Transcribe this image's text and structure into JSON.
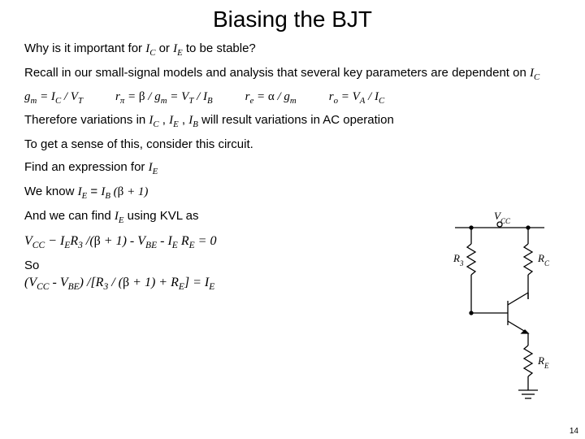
{
  "title": "Biasing the BJT",
  "why_pre": "Why is it important for ",
  "why_ic": "I",
  "why_icsub": "C",
  "why_or": " or ",
  "why_ie": "I",
  "why_iesub": "E",
  "why_post": " to be stable?",
  "recall_a": "Recall in our small-signal models and analysis that several key parameters are dependent on ",
  "recall_ic": "I",
  "recall_icsub": "C",
  "eq1_a": "g",
  "eq1_b": "m",
  "eq1_c": " = I",
  "eq1_d": "C",
  "eq1_e": " / V",
  "eq1_f": "T",
  "eq2_a": "r",
  "eq2_b": "π",
  "eq2_c": " = ",
  "eq2_d": "β",
  "eq2_e": " / g",
  "eq2_f": "m",
  "eq2_g": " = V",
  "eq2_h": "T",
  "eq2_i": " / I",
  "eq2_j": "B",
  "eq3_a": "r",
  "eq3_b": "e",
  "eq3_c": "  =  ",
  "eq3_d": "α",
  "eq3_e": " / g",
  "eq3_f": "m",
  "eq4_a": "r",
  "eq4_b": "o",
  "eq4_c": " = V",
  "eq4_d": "A",
  "eq4_e": " / I",
  "eq4_f": "C",
  "therefore_a": "Therefore variations in ",
  "therefore_ic": "I",
  "therefore_icsub": "C",
  "therefore_sep1": " , ",
  "therefore_ie": "I",
  "therefore_iesub": "E",
  "therefore_sep2": " , ",
  "therefore_ib": "I",
  "therefore_ibsub": "B",
  "therefore_b": " will result variations in AC operation",
  "sense": "To get a sense of this, consider this circuit.",
  "find_a": "Find an expression for ",
  "find_ie": "I",
  "find_iesub": "E",
  "know_a": "We know ",
  "know_ie": "I",
  "know_iesub": "E",
  "know_eq": " =  ",
  "know_ib": "I",
  "know_ibsub": "B",
  "know_open": " (",
  "know_beta": "β",
  "know_plus": " + 1)",
  "kvl_label": "And we can find ",
  "kvl_ie": "I",
  "kvl_iesub": "E",
  "kvl_using": " using KVL as",
  "kvl_eq_a": "V",
  "kvl_eq_asub": "CC",
  "kvl_eq_b": " − I",
  "kvl_eq_bsub": "E",
  "kvl_eq_c": "R",
  "kvl_eq_csub": "3",
  "kvl_eq_d": " /(",
  "kvl_eq_beta": "β",
  "kvl_eq_e": " + 1) - V",
  "kvl_eq_esub": "BE",
  "kvl_eq_f": " - I",
  "kvl_eq_fsub": "E",
  "kvl_eq_g": " R",
  "kvl_eq_gsub": "E",
  "kvl_eq_h": " =  0",
  "so": "So",
  "final_a": " (V",
  "final_asub": "CC",
  "final_b": " - V",
  "final_bsub": "BE",
  "final_c": ") /[R",
  "final_csub": "3",
  "final_d": " / (",
  "final_beta": "β",
  "final_e": " + 1) + R",
  "final_esub": "E",
  "final_f": "] = I",
  "final_fsub": "E",
  "circuit": {
    "vcc": "V",
    "vccsub": "CC",
    "r3": "R",
    "r3sub": "3",
    "rc": "R",
    "rcsub": "C",
    "re": "R",
    "resub": "E"
  },
  "pagenum": "14"
}
